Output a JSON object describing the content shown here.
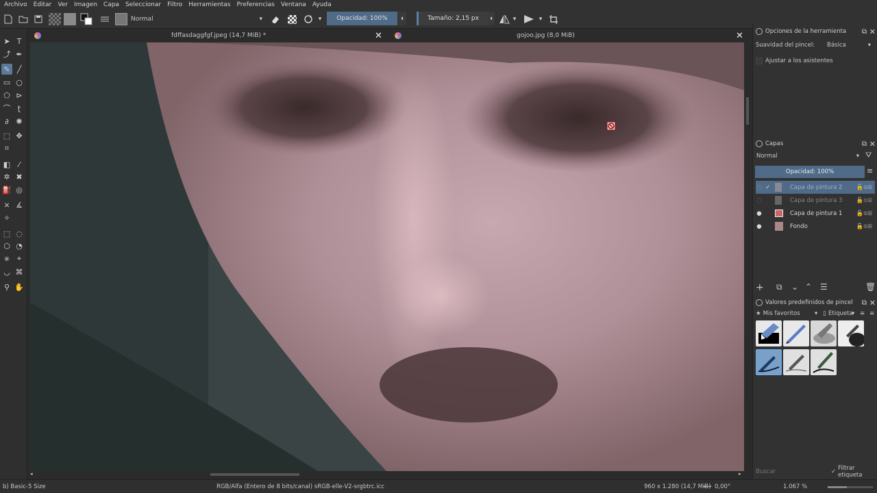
{
  "menu": [
    "Archivo",
    "Editar",
    "Ver",
    "Imagen",
    "Capa",
    "Seleccionar",
    "Filtro",
    "Herramientas",
    "Preferencias",
    "Ventana",
    "Ayuda"
  ],
  "toolbar": {
    "blend_mode": "Normal",
    "opacity": "Opacidad: 100%",
    "size": "Tamaño: 2,15 px"
  },
  "tabs": [
    {
      "title": "fdffasdaggfgf.jpeg (14,7 MiB) *"
    },
    {
      "title": "gojoo.jpg (8,0 MiB)"
    }
  ],
  "tool_options": {
    "title": "Opciones de la herramienta",
    "smoothing_label": "Suavidad del pincel:",
    "smoothing_value": "Básica",
    "assistants_label": "Ajustar a los asistentes"
  },
  "layers": {
    "title": "Capas",
    "blend_mode": "Normal",
    "opacity": "Opacidad:  100%",
    "items": [
      {
        "name": "Capa de pintura 2"
      },
      {
        "name": "Capa de pintura 3"
      },
      {
        "name": "Capa de pintura 1"
      },
      {
        "name": "Fondo"
      }
    ]
  },
  "presets": {
    "title": "Valores predefinidos de pincel",
    "favorites": "Mis favoritos",
    "tag": "Etiqueta",
    "search_placeholder": "Buscar",
    "filter_label": "Filtrar etiqueta"
  },
  "status": {
    "brush": "b) Basic-5 Size",
    "color_space": "RGB/Alfa (Entero de 8 bits/canal)  sRGB-elle-V2-srgbtrc.icc",
    "dimensions": "960 x 1.280 (14,7 MiB)",
    "rotation": "0,00°",
    "zoom": "1.067 %"
  }
}
